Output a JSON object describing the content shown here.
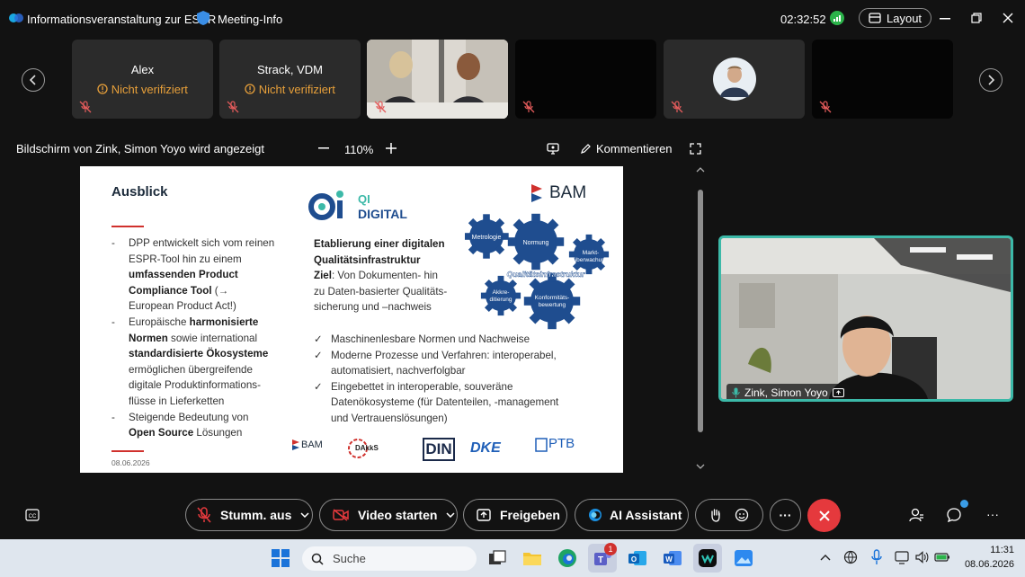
{
  "titlebar": {
    "meeting_title": "Informationsveranstaltung zur ESPR",
    "meeting_info": "Meeting-Info",
    "timer": "02:32:52",
    "layout_label": "Layout"
  },
  "participants": [
    {
      "name": "Alex",
      "status": "Nicht verifiziert"
    },
    {
      "name": "Strack, VDM",
      "status": "Nicht verifiziert"
    }
  ],
  "share_bar": {
    "label": "Bildschirm von Zink, Simon Yoyo wird angezeigt",
    "zoom": "110%",
    "comment_label": "Kommentieren"
  },
  "slide": {
    "title": "Ausblick",
    "qi_title_1": "QI",
    "qi_title_2": "DIGITAL",
    "brand": "BAM",
    "left_bullets": [
      {
        "dash": "-",
        "lines": [
          [
            {
              "t": "DPP entwickelt sich vom reinen"
            }
          ],
          [
            {
              "t": "ESPR-Tool hin zu einem"
            }
          ],
          [
            {
              "t": "umfassenden Product",
              "b": true
            }
          ],
          [
            {
              "t": "Compliance Tool",
              "b": true
            },
            {
              "t": " (→"
            }
          ],
          [
            {
              "t": "European Product Act!)"
            }
          ]
        ]
      },
      {
        "dash": "-",
        "lines": [
          [
            {
              "t": "Europäische "
            },
            {
              "t": "harmonisierte",
              "b": true
            }
          ],
          [
            {
              "t": "Normen",
              "b": true
            },
            {
              "t": " sowie international"
            }
          ],
          [
            {
              "t": "standardisierte Ökosysteme",
              "b": true
            }
          ],
          [
            {
              "t": "ermöglichen übergreifende"
            }
          ],
          [
            {
              "t": "digitale Produktinformations-"
            }
          ],
          [
            {
              "t": "flüsse in Lieferketten"
            }
          ]
        ]
      },
      {
        "dash": "-",
        "lines": [
          [
            {
              "t": "Steigende Bedeutung von"
            }
          ],
          [
            {
              "t": "Open Source",
              "b": true
            },
            {
              "t": " Lösungen"
            }
          ]
        ]
      }
    ],
    "mid_heading_1": "Etablierung einer digitalen",
    "mid_heading_2": "Qualitätsinfrastruktur",
    "ziel_label": "Ziel",
    "ziel_text_1": ": Von Dokumenten- hin",
    "ziel_text_2": "zu Daten-basierter Qualitäts-",
    "ziel_text_3": "sicherung und –nachweis",
    "checks": [
      {
        "lines": [
          "Maschinenlesbare Normen und Nachweise"
        ]
      },
      {
        "lines": [
          "Moderne Prozesse und Verfahren: interoperabel,",
          "automatisiert, nachverfolgbar"
        ]
      },
      {
        "lines": [
          "Eingebettet in interoperable, souveräne",
          "Datenökosysteme (für Datenteilen, -management",
          "und Vertrauenslösungen)"
        ]
      }
    ],
    "gears": {
      "metrologie": "Metrologie",
      "normung": "Normung",
      "markt_1": "Markt-",
      "markt_2": "überwachung",
      "qi": "Qualitätsinfrastruktur",
      "akkred_1": "Akkre-",
      "akkred_2": "ditierung",
      "konf_1": "Konformitäts-",
      "konf_2": "bewertung"
    },
    "date": "08.06.2026",
    "logos": {
      "bam": "BAM",
      "dakks": "DAkkS",
      "din": "DIN",
      "dke": "DKE",
      "ptb": "PTB"
    }
  },
  "selfview": {
    "name": "Zink, Simon Yoyo"
  },
  "controls": {
    "mute": "Stumm. aus",
    "video": "Video starten",
    "share": "Freigeben",
    "ai": "AI Assistant",
    "more": "···"
  },
  "taskbar": {
    "search_placeholder": "Suche",
    "time": "11:31",
    "date": "08.06.2026",
    "teams_badge": "1"
  },
  "colors": {
    "accent_teal": "#3cb9a8",
    "end_call_red": "#e5393d",
    "warning_orange": "#e8a03a",
    "slide_red": "#d0312d",
    "gear_blue": "#1f4d8f"
  }
}
